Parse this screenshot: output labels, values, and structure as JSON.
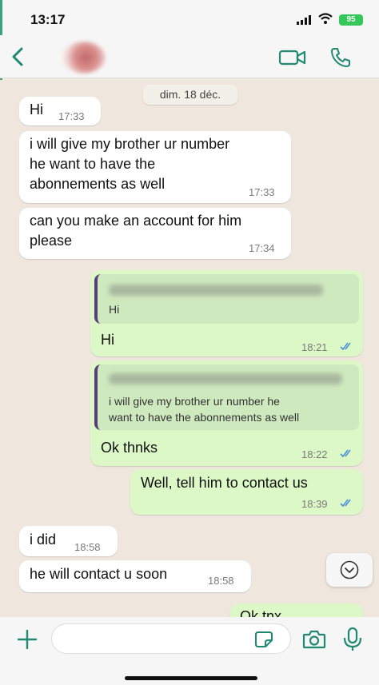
{
  "status_bar": {
    "time": "13:17",
    "battery": "95",
    "icons": [
      "signal-icon",
      "wifi-icon",
      "battery-icon"
    ]
  },
  "header": {
    "icons": [
      "back-icon",
      "video-call-icon",
      "phone-call-icon"
    ]
  },
  "date_chip": "dim. 18 déc.",
  "messages": [
    {
      "direction": "in",
      "text": "Hi",
      "time": "17:33"
    },
    {
      "direction": "in",
      "text": "i will give my brother ur number\nhe want to have the\nabonnements as well",
      "time": "17:33"
    },
    {
      "direction": "in",
      "text": "can you make an account for him\nplease",
      "time": "17:34"
    },
    {
      "direction": "out",
      "quote_text": "Hi",
      "text": "Hi",
      "time": "18:21",
      "status": "read"
    },
    {
      "direction": "out",
      "quote_text": "i will give my brother ur number he\nwant to have the abonnements as well",
      "text": "Ok thnks",
      "time": "18:22",
      "status": "read"
    },
    {
      "direction": "out",
      "text": "Well, tell him to contact us",
      "time": "18:39",
      "status": "read"
    },
    {
      "direction": "in",
      "text": "i did",
      "time": "18:58"
    },
    {
      "direction": "in",
      "text": "he will contact u soon",
      "time": "18:58"
    },
    {
      "direction": "out",
      "text": "Ok tnx",
      "partial": true
    }
  ],
  "input_bar": {
    "placeholder": "",
    "value": "",
    "icons": [
      "plus-icon",
      "sticker-icon",
      "camera-icon",
      "microphone-icon"
    ]
  },
  "colors": {
    "incoming_bubble": "#ffffff",
    "outgoing_bubble": "#dcf8c6",
    "chat_background": "#efe7de",
    "accent": "#1f8a70",
    "read_ticks": "#4a90d9"
  }
}
